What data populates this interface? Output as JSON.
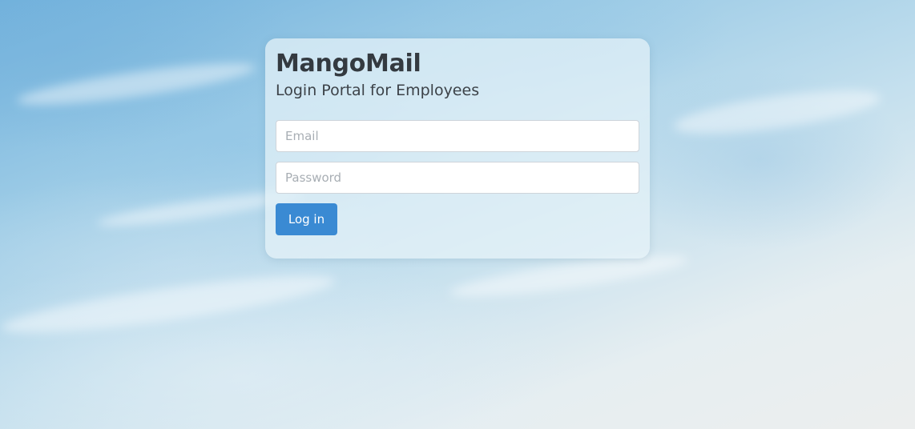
{
  "login": {
    "title": "MangoMail",
    "subtitle": "Login Portal for Employees",
    "email_placeholder": "Email",
    "password_placeholder": "Password",
    "submit_label": "Log in"
  },
  "colors": {
    "button": "#3a8ad3",
    "title_text": "#343a40"
  }
}
